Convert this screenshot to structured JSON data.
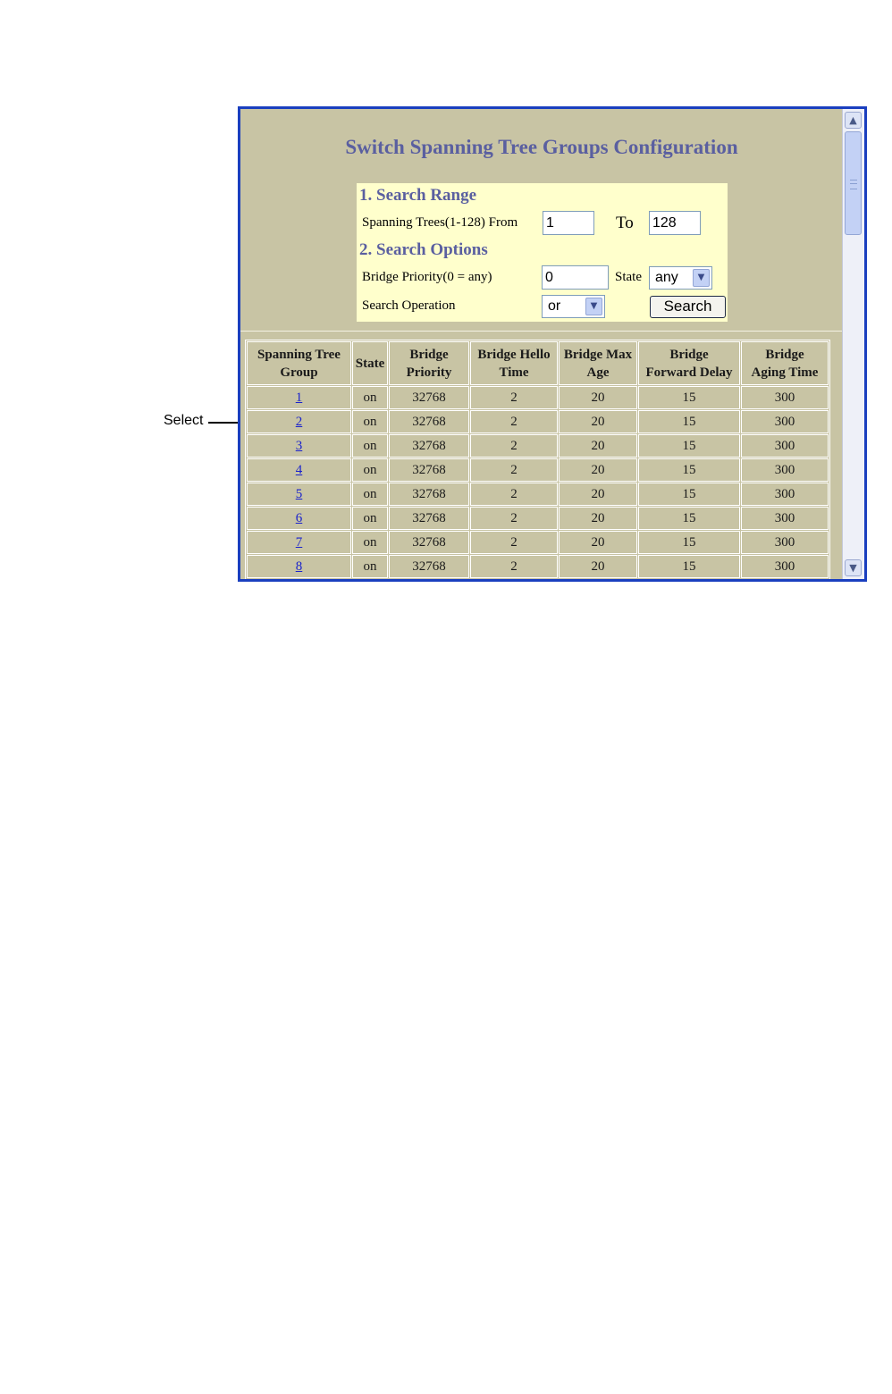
{
  "callout": {
    "label": "Select"
  },
  "title": "Switch Spanning Tree Groups Configuration",
  "search": {
    "range_heading": "1. Search Range",
    "range_label": "Spanning Trees(1-128) From",
    "from_value": "1",
    "to_label": "To",
    "to_value": "128",
    "options_heading": "2. Search Options",
    "priority_label": "Bridge Priority(0 = any)",
    "priority_value": "0",
    "state_label": "State",
    "state_value": "any",
    "operation_label": "Search Operation",
    "operation_value": "or",
    "search_button": "Search"
  },
  "table": {
    "columns": [
      [
        "Spanning Tree",
        "Group"
      ],
      [
        "State"
      ],
      [
        "Bridge",
        "Priority"
      ],
      [
        "Bridge Hello",
        "Time"
      ],
      [
        "Bridge Max",
        "Age"
      ],
      [
        "Bridge",
        "Forward Delay"
      ],
      [
        "Bridge",
        "Aging Time"
      ]
    ],
    "rows": [
      [
        "1",
        "on",
        "32768",
        "2",
        "20",
        "15",
        "300"
      ],
      [
        "2",
        "on",
        "32768",
        "2",
        "20",
        "15",
        "300"
      ],
      [
        "3",
        "on",
        "32768",
        "2",
        "20",
        "15",
        "300"
      ],
      [
        "4",
        "on",
        "32768",
        "2",
        "20",
        "15",
        "300"
      ],
      [
        "5",
        "on",
        "32768",
        "2",
        "20",
        "15",
        "300"
      ],
      [
        "6",
        "on",
        "32768",
        "2",
        "20",
        "15",
        "300"
      ],
      [
        "7",
        "on",
        "32768",
        "2",
        "20",
        "15",
        "300"
      ],
      [
        "8",
        "on",
        "32768",
        "2",
        "20",
        "15",
        "300"
      ]
    ]
  },
  "icons": {
    "scroll_up": "chevron-up-icon",
    "scroll_down": "chevron-down-icon",
    "dropdown": "chevron-down-icon"
  },
  "colors": {
    "window_border": "#1a3fbf",
    "panel_background": "#c8c4a4",
    "search_background": "#ffffcc",
    "heading": "#5a5fa0",
    "link": "#1a22cc"
  }
}
